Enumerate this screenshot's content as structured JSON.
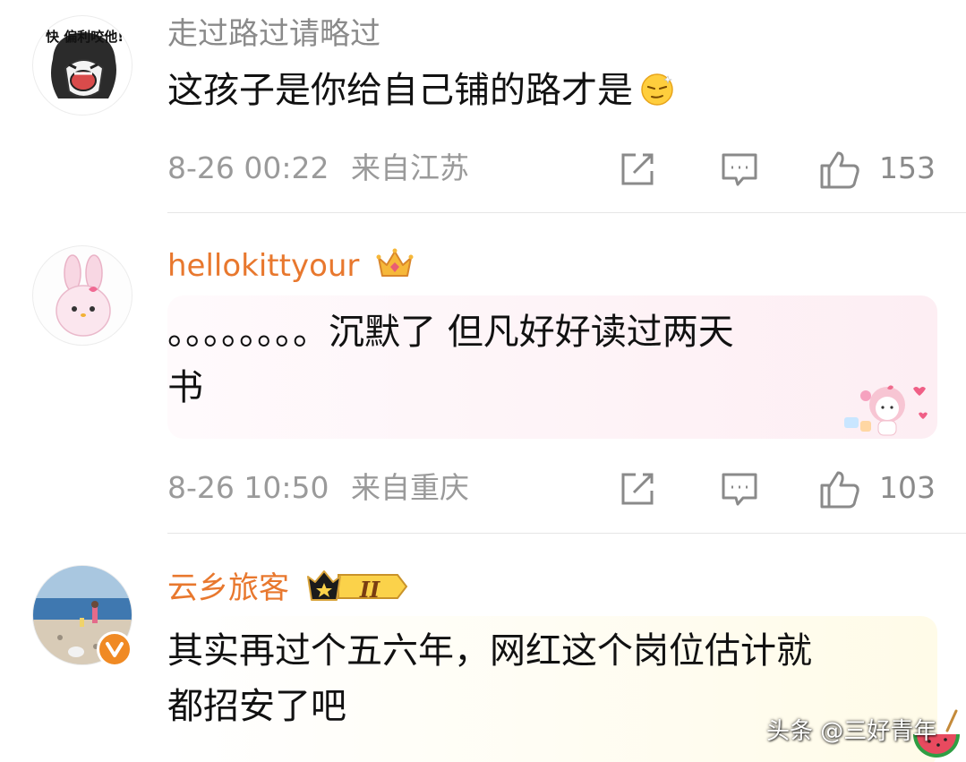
{
  "comments": [
    {
      "username": "走过路过请略过",
      "avatar_text": "快 偏利咬他!",
      "text": "这孩子是你给自己铺的路才是",
      "emoji": "sleepy-face-emoji",
      "timestamp": "8-26 00:22",
      "location": "来自江苏",
      "likes": "153"
    },
    {
      "username": "hellokittyour",
      "badge": "crown-badge-icon",
      "text_line1": "。。。。。。。。沉默了 但凡好好读过两天",
      "text_line2": "书",
      "timestamp": "8-26 10:50",
      "location": "来自重庆",
      "likes": "103"
    },
    {
      "username": "云乡旅客",
      "badge_level": "II",
      "text_line1": "其实再过个五六年，网红这个岗位估计就",
      "text_line2": "都招安了吧"
    }
  ],
  "watermark": "头条 @三好青年",
  "colors": {
    "username_grey": "#8a8a8a",
    "username_orange": "#e8782e",
    "meta_grey": "#9a9a9a",
    "verified_orange": "#f08a24"
  }
}
